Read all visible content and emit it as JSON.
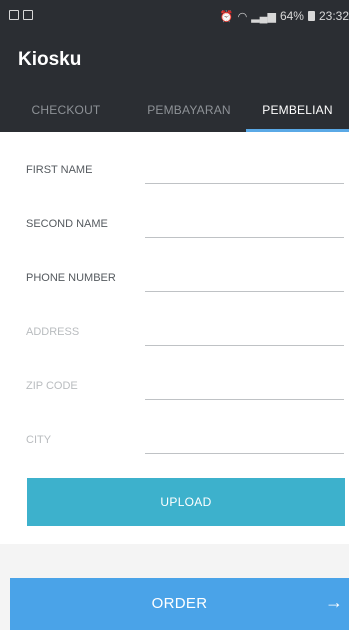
{
  "status_bar": {
    "left_icons": [
      "image-icon",
      "gallery-icon"
    ],
    "right_icons": [
      "alarm-icon",
      "wifi-icon",
      "signal-icon"
    ],
    "battery": "64%",
    "time": "23:32"
  },
  "app": {
    "title": "Kiosku"
  },
  "tabs": [
    {
      "label": "CHECKOUT",
      "active": false
    },
    {
      "label": "PEMBAYARAN",
      "active": false
    },
    {
      "label": "PEMBELIAN",
      "active": true
    }
  ],
  "form": {
    "fields": [
      {
        "label": "FIRST NAME",
        "value": ""
      },
      {
        "label": "SECOND NAME",
        "value": ""
      },
      {
        "label": "PHONE NUMBER",
        "value": ""
      },
      {
        "label": "ADDRESS",
        "value": ""
      },
      {
        "label": "ZIP CODE",
        "value": ""
      },
      {
        "label": "CITY",
        "value": ""
      }
    ],
    "upload_label": "UPLOAD"
  },
  "order": {
    "label": "ORDER",
    "arrow": "→"
  },
  "colors": {
    "app_bar": "#2b2e33",
    "tab_indicator": "#5aa9e6",
    "upload_button": "#3db1cc",
    "order_bar": "#4aa3e8"
  }
}
